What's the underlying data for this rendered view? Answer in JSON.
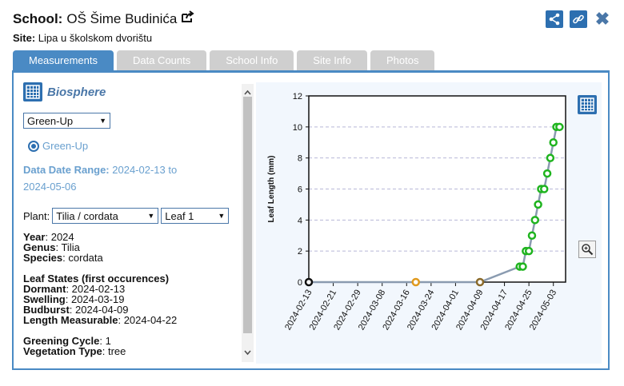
{
  "header": {
    "school_label": "School:",
    "school_name": "OŠ Šime Budinića",
    "site_label": "Site:",
    "site_name": "Lipa u školskom dvorištu"
  },
  "icons": {
    "share": "share-icon",
    "link": "link-icon",
    "close": "close-icon",
    "external": "external-link-icon",
    "table": "table-icon",
    "zoom": "zoom-icon"
  },
  "tabs": [
    {
      "label": "Measurements",
      "active": true
    },
    {
      "label": "Data Counts",
      "active": false
    },
    {
      "label": "School Info",
      "active": false
    },
    {
      "label": "Site Info",
      "active": false
    },
    {
      "label": "Photos",
      "active": false
    }
  ],
  "left": {
    "protocol_title": "Biosphere",
    "measure_select": "Green-Up",
    "radio_label": "Green-Up",
    "range_label": "Data Date Range:",
    "range_value_1": "2024-02-13 to",
    "range_value_2": "2024-05-06",
    "plant_label": "Plant:",
    "plant_select": "Tilia / cordata",
    "leaf_select": "Leaf 1",
    "year_label": "Year",
    "year_value": ": 2024",
    "genus_label": "Genus",
    "genus_value": ": Tilia",
    "species_label": "Species",
    "species_value": ": cordata",
    "states_heading": "Leaf States (first occurences)",
    "dormant_label": "Dormant",
    "dormant_value": ": 2024-02-13",
    "swelling_label": "Swelling",
    "swelling_value": ": 2024-03-19",
    "budburst_label": "Budburst",
    "budburst_value": ": 2024-04-09",
    "measurable_label": "Length Measurable",
    "measurable_value": ": 2024-04-22",
    "cycle_label": "Greening Cycle",
    "cycle_value": ": 1",
    "veg_label": "Vegetation Type",
    "veg_value": ": tree"
  },
  "chart_data": {
    "type": "line",
    "ylabel": "Leaf Length (mm)",
    "xlabel": "",
    "ylim": [
      0,
      12
    ],
    "yticks": [
      0,
      2,
      4,
      6,
      8,
      10,
      12
    ],
    "xlim": [
      "2024-02-13",
      "2024-05-07"
    ],
    "xticks": [
      "2024-02-13",
      "2024-02-21",
      "2024-02-29",
      "2024-03-08",
      "2024-03-16",
      "2024-03-24",
      "2024-04-01",
      "2024-04-09",
      "2024-04-17",
      "2024-04-25",
      "2024-05-03"
    ],
    "grid": "horizontal dashed",
    "points": [
      {
        "x": "2024-02-13",
        "y": 0,
        "color": "#111111"
      },
      {
        "x": "2024-03-19",
        "y": 0,
        "color": "#e09a1e"
      },
      {
        "x": "2024-04-09",
        "y": 0,
        "color": "#8a6a2a"
      },
      {
        "x": "2024-04-22",
        "y": 1,
        "color": "#1fb41f"
      },
      {
        "x": "2024-04-23",
        "y": 1,
        "color": "#1fb41f"
      },
      {
        "x": "2024-04-24",
        "y": 2,
        "color": "#1fb41f"
      },
      {
        "x": "2024-04-25",
        "y": 2,
        "color": "#1fb41f"
      },
      {
        "x": "2024-04-26",
        "y": 3,
        "color": "#1fb41f"
      },
      {
        "x": "2024-04-27",
        "y": 4,
        "color": "#1fb41f"
      },
      {
        "x": "2024-04-28",
        "y": 5,
        "color": "#1fb41f"
      },
      {
        "x": "2024-04-29",
        "y": 6,
        "color": "#1fb41f"
      },
      {
        "x": "2024-04-30",
        "y": 6,
        "color": "#1fb41f"
      },
      {
        "x": "2024-05-01",
        "y": 7,
        "color": "#1fb41f"
      },
      {
        "x": "2024-05-02",
        "y": 8,
        "color": "#1fb41f"
      },
      {
        "x": "2024-05-03",
        "y": 9,
        "color": "#1fb41f"
      },
      {
        "x": "2024-05-04",
        "y": 10,
        "color": "#1fb41f"
      },
      {
        "x": "2024-05-05",
        "y": 10,
        "color": "#1fb41f"
      }
    ]
  }
}
